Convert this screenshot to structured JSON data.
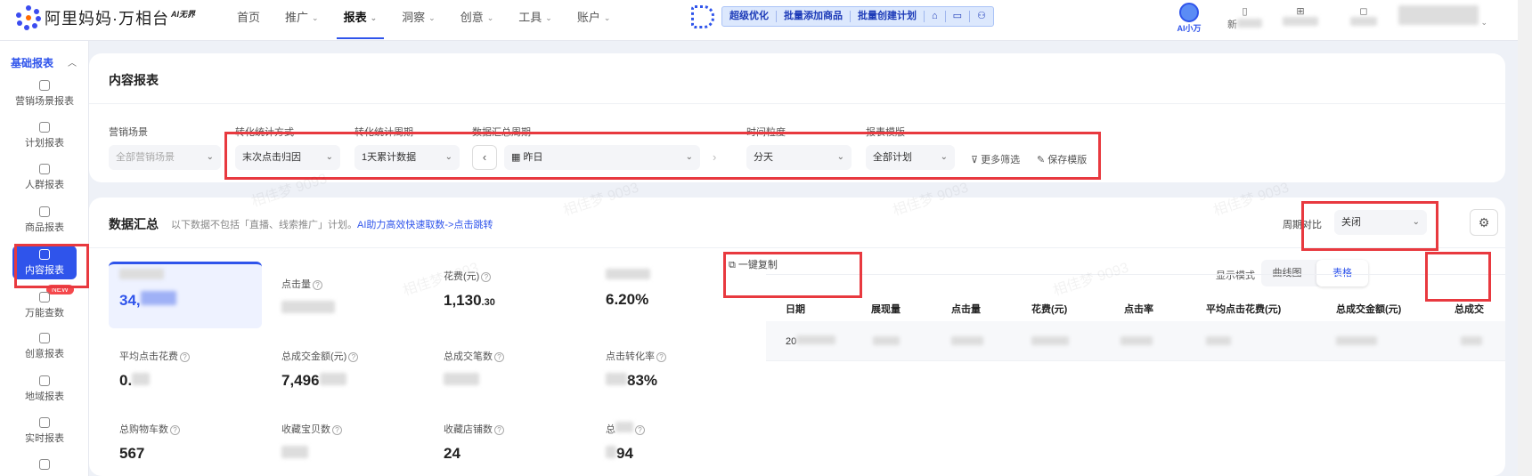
{
  "logo": {
    "name": "阿里妈妈·万相台",
    "badge": "AI无界"
  },
  "nav": [
    {
      "label": "首页",
      "dropdown": false
    },
    {
      "label": "推广",
      "dropdown": true
    },
    {
      "label": "报表",
      "dropdown": true,
      "active": true
    },
    {
      "label": "洞察",
      "dropdown": true
    },
    {
      "label": "创意",
      "dropdown": true
    },
    {
      "label": "工具",
      "dropdown": true
    },
    {
      "label": "账户",
      "dropdown": true
    }
  ],
  "quickbar": [
    "超级优化",
    "批量添加商品",
    "批量创建计划"
  ],
  "ai_helper": "AI小万",
  "top_util": {
    "new_label": "新"
  },
  "sidebar": {
    "section": "基础报表",
    "items": [
      "营销场景报表",
      "计划报表",
      "人群报表",
      "商品报表",
      "内容报表",
      "万能查数",
      "创意报表",
      "地域报表",
      "实时报表"
    ],
    "new_badge": "NEW"
  },
  "filter_card": {
    "title": "内容报表",
    "labels": {
      "scene": "营销场景",
      "method": "转化统计方式",
      "cycle": "转化统计周期",
      "summary": "数据汇总周期",
      "granularity": "时间粒度",
      "template": "报表模版"
    },
    "values": {
      "scene": "全部营销场景",
      "method": "末次点击归因",
      "cycle": "1天累计数据",
      "date": "昨日",
      "granularity": "分天",
      "template": "全部计划"
    },
    "more_filter": "更多筛选",
    "save_template": "保存模版"
  },
  "summary": {
    "title": "数据汇总",
    "note": "以下数据不包括「直播、线索推广」计划。",
    "link": "AI助力高效快速取数->点击跳转",
    "period_label": "周期对比",
    "period_value": "关闭",
    "copy_button": "一键复制",
    "mode_label": "显示模式",
    "modes": [
      "曲线图",
      "表格"
    ],
    "metrics": [
      {
        "label": "",
        "value": "34,"
      },
      {
        "label": "点击量",
        "value": ""
      },
      {
        "label": "花费(元)",
        "value": "1,130",
        "suffix": ".30"
      },
      {
        "label": "",
        "value": "6.20%"
      },
      {
        "label": "平均点击花费",
        "value": "0."
      },
      {
        "label": "总成交金额(元)",
        "value": "7,496"
      },
      {
        "label": "总成交笔数",
        "value": ""
      },
      {
        "label": "点击转化率",
        "value": "83%"
      },
      {
        "label": "总购物车数",
        "value": "567"
      },
      {
        "label": "收藏宝贝数",
        "value": ""
      },
      {
        "label": "收藏店铺数",
        "value": "24"
      },
      {
        "label": "总",
        "value": "94"
      }
    ],
    "table_headers": [
      "日期",
      "展现量",
      "点击量",
      "花费(元)",
      "点击率",
      "平均点击花费(元)",
      "总成交金额(元)",
      "总成交"
    ],
    "row_date": "20"
  },
  "watermark": "相佳梦 9093"
}
